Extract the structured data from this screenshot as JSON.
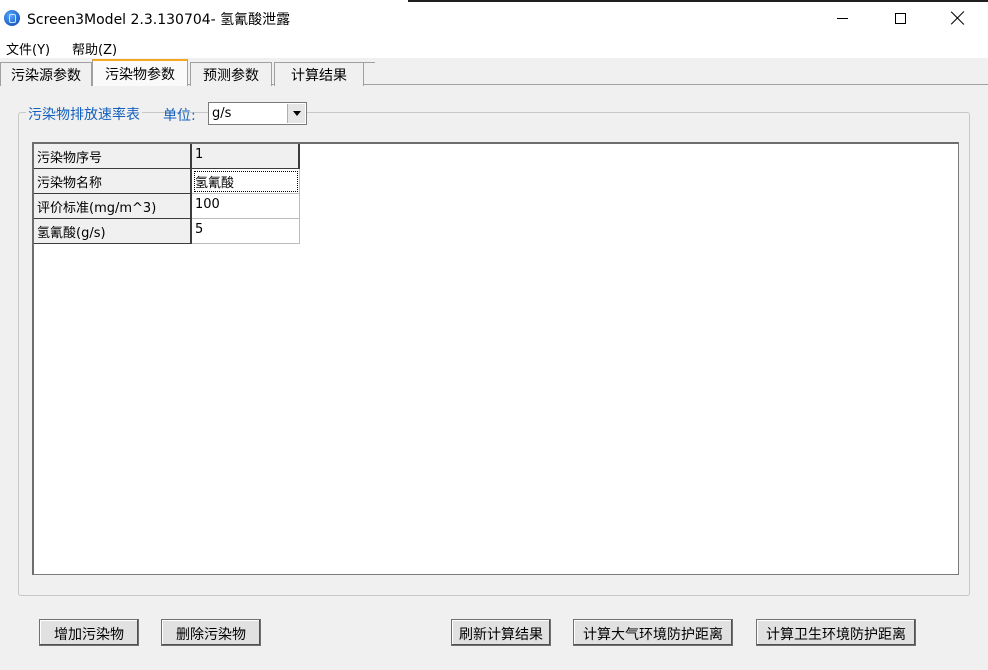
{
  "window": {
    "title": "Screen3Model 2.3.130704- 氢氰酸泄露"
  },
  "menu": {
    "items": [
      {
        "label": "文件(Y)"
      },
      {
        "label": "帮助(Z)"
      }
    ]
  },
  "tabs": [
    {
      "label": "污染源参数",
      "selected": false
    },
    {
      "label": "污染物参数",
      "selected": true
    },
    {
      "label": "预测参数",
      "selected": false
    },
    {
      "label": "计算结果",
      "selected": false
    }
  ],
  "emission_group": {
    "caption": "污染物排放速率表",
    "unit_label": "单位:",
    "unit_value": "g/s"
  },
  "grid": {
    "rows": [
      {
        "header": "污染物序号",
        "value": "1"
      },
      {
        "header": "污染物名称",
        "value": "氢氰酸"
      },
      {
        "header": "评价标准(mg/m^3)",
        "value": "100"
      },
      {
        "header": "氢氰酸(g/s)",
        "value": "5"
      }
    ]
  },
  "buttons": {
    "add": "增加污染物",
    "delete": "删除污染物",
    "refresh": "刷新计算结果",
    "atmospheric": "计算大气环境防护距离",
    "sanitary": "计算卫生环境防护距离"
  },
  "colors": {
    "accent_caption": "#1560bd",
    "selected_tab_marker": "#f5a623",
    "window_bg": "#f0f0f0"
  },
  "icons": {
    "app": "app-globe-icon",
    "minimize": "minimize-icon",
    "maximize": "maximize-icon",
    "close": "close-icon",
    "dropdown": "chevron-down-icon"
  }
}
